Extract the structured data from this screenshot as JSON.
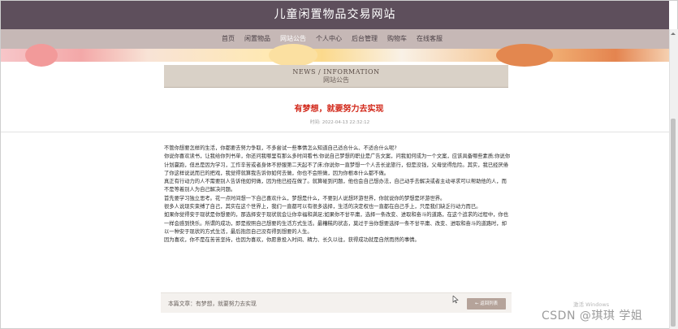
{
  "site": {
    "title": "儿童闲置物品交易网站"
  },
  "nav": {
    "items": [
      {
        "label": "首页",
        "active": false
      },
      {
        "label": "闲置物品",
        "active": false
      },
      {
        "label": "网站公告",
        "active": true
      },
      {
        "label": "个人中心",
        "active": false
      },
      {
        "label": "后台管理",
        "active": false
      },
      {
        "label": "购物车",
        "active": false
      },
      {
        "label": "在线客服",
        "active": false
      }
    ]
  },
  "section": {
    "title_en": "NEWS / INFORMATION",
    "title_cn": "网站公告"
  },
  "article": {
    "title": "有梦想，就要努力去实现",
    "time_label": "时间:",
    "time_value": "2022-04-13 22:32:12",
    "paragraphs": [
      "不管你想要怎样的生活，你都要去努力争取，不多尝试一些事情怎么知道自己适合什么、不适合什么呢?",
      "你说你喜欢读书，让我给你列书单，你还问我哪里有那么多时间看书;你说自己梦想的职业是广告文案，问我如何成为一个文案，应该具备哪些素质;你说你计划赢跑，但总是因为学习，工作辛苦或者身体不舒服第二天起不了床;你说你一直梦想一个人去长途旅行，但是没钱，父母觉得危险。其实，我已经厌倦了你这样说说而已的把戏，我觉得就算我告诉你如何去做，你也不会照做，因为你根本什么都不做。",
      "真正有行动力的人不需要别人告诉他如何做，因为他已经在做了。就算碰到问题，他也会自己想办法，自己动手去解决或者主动寻求可以帮助他的人，而不是等着别人为自己解决问题。",
      "首先要学习独立思考。花一点时间想一下自己喜欢什么，梦想是什么，不要别人说想环游世界，你就说你的梦想是环游世界。",
      "很多人说现实束缚了自己，其实在这个世界上，我们一直都可以有很多选择，生活的决定权也一直都在自己手上，只是我们缺乏行动力而已。",
      "如果你觉得安于现状是你想要的，那选择安于现状就会让你幸福和满足;如果你不甘平庸，选择一条改变、进取和奋斗的道路，在这个追求的过程中，你也一样会感到快乐。所谓的成功，即是按照自己想要的生活方式生活。最糟糕的状态，莫过于当你想要选择一条不甘平庸、改变、进取和奋斗的道路时，却以一种安于现状的方式生活，最后抱怨自己没有得到想要的人生。",
      "因为喜欢，你不是在苦苦坚持，也因为喜欢，你愿意投入时间、精力、长久以往，获得成功就是自然而然的事情。"
    ]
  },
  "footer": {
    "article_label": "本篇文章：有梦想，就要努力去实现",
    "back_button": "返回列表"
  },
  "overlay": {
    "windows_watermark": "激活 Windows",
    "csdn_watermark": "CSDN @琪琪 学姐"
  },
  "colors": {
    "header_bg": "#5e4f5c",
    "nav_bg": "#c6b8b6",
    "title_red": "#d2281a",
    "button_bg": "#b5a39a"
  }
}
